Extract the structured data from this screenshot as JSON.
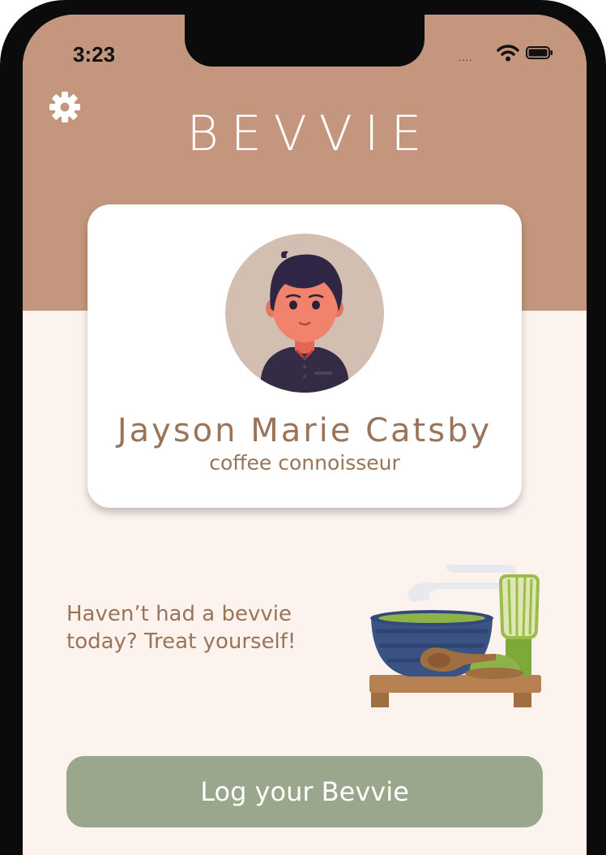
{
  "status_bar": {
    "time": "3:23",
    "signal": "....",
    "wifi_icon": "wifi-icon",
    "battery_icon": "battery-icon"
  },
  "header": {
    "title": "BEVVIE",
    "settings_icon": "gear-icon",
    "background_color": "#c3967d"
  },
  "profile": {
    "name": "Jayson Marie Catsby",
    "tagline": "coffee connoisseur",
    "avatar_icon": "person-avatar"
  },
  "promo": {
    "text": "Haven’t had a bevvie\ntoday? Treat yourself!",
    "illustration": "matcha-set-illustration"
  },
  "actions": {
    "log_label": "Log your Bevvie",
    "log_color": "#9aa78c"
  },
  "colors": {
    "page_bg": "#fcf3ef",
    "text_brown": "#9a7458"
  }
}
